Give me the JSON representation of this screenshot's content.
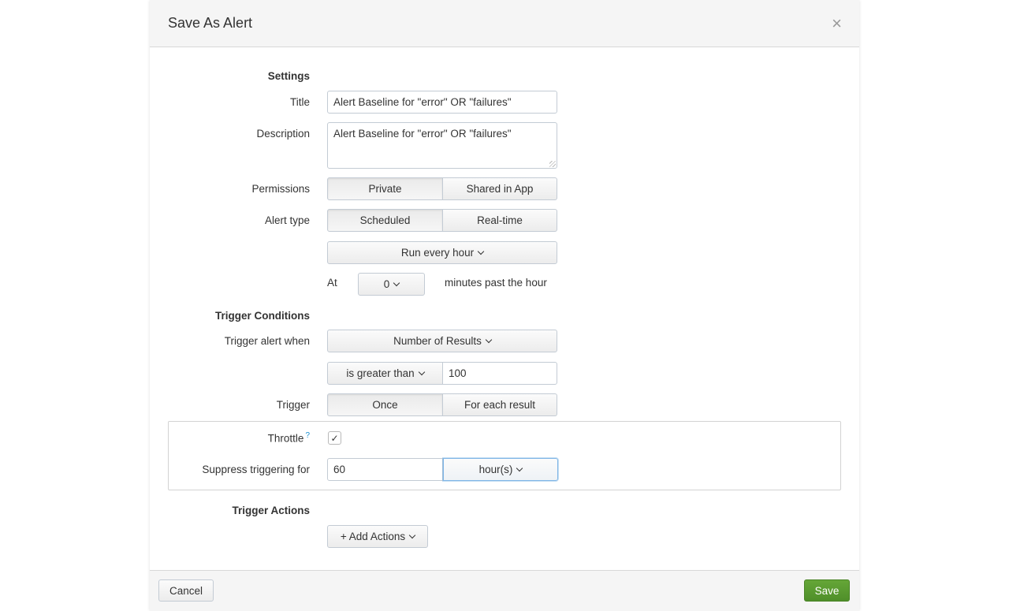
{
  "dialog": {
    "title": "Save As Alert",
    "close_symbol": "×"
  },
  "settings": {
    "section_label": "Settings",
    "title_label": "Title",
    "title_value": "Alert Baseline for \"error\" OR \"failures\"",
    "description_label": "Description",
    "description_value": "Alert Baseline for \"error\" OR \"failures\"",
    "permissions_label": "Permissions",
    "permissions_options": [
      "Private",
      "Shared in App"
    ],
    "permissions_selected": "Private",
    "alert_type_label": "Alert type",
    "alert_type_options": [
      "Scheduled",
      "Real-time"
    ],
    "alert_type_selected": "Scheduled",
    "schedule_value": "Run every hour",
    "at_label": "At",
    "minute_value": "0",
    "minutes_suffix": "minutes past the hour"
  },
  "trigger_conditions": {
    "section_label": "Trigger Conditions",
    "trigger_when_label": "Trigger alert when",
    "trigger_when_value": "Number of Results",
    "comparator_value": "is greater than",
    "threshold_value": "100",
    "trigger_label": "Trigger",
    "trigger_options": [
      "Once",
      "For each result"
    ],
    "trigger_selected": "Once",
    "throttle_label": "Throttle",
    "throttle_help": "?",
    "throttle_checked": true,
    "throttle_check_mark": "✓",
    "suppress_label": "Suppress triggering for",
    "suppress_value": "60",
    "suppress_unit": "hour(s)"
  },
  "trigger_actions": {
    "section_label": "Trigger Actions",
    "add_actions_label": "+ Add Actions"
  },
  "footer": {
    "cancel_label": "Cancel",
    "save_label": "Save"
  },
  "colors": {
    "save_button": "#5a9e32",
    "focus_border": "#7fb5e6",
    "help_link": "#1a8fd1"
  }
}
